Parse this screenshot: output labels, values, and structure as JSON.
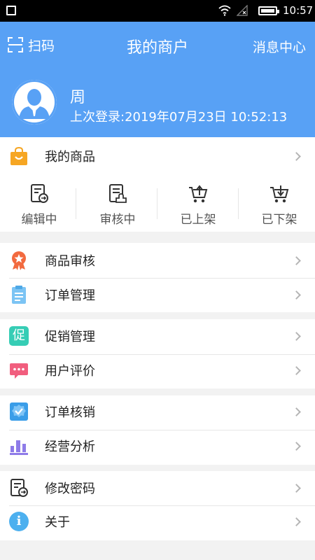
{
  "statusbar": {
    "time": "10:57"
  },
  "header": {
    "scan_label": "扫码",
    "title": "我的商户",
    "message_center": "消息中心"
  },
  "user": {
    "name": "周",
    "last_login": "上次登录:2019年07月23日 10:52:13"
  },
  "my_goods": {
    "label": "我的商品"
  },
  "goods_status": [
    {
      "label": "编辑中",
      "icon": "edit-doc-icon"
    },
    {
      "label": "审核中",
      "icon": "review-doc-icon"
    },
    {
      "label": "已上架",
      "icon": "cart-up-icon"
    },
    {
      "label": "已下架",
      "icon": "cart-down-icon"
    }
  ],
  "menu": {
    "goods_review": "商品审核",
    "order_manage": "订单管理",
    "promotion_manage": "促销管理",
    "user_review": "用户评价",
    "order_verify": "订单核销",
    "business_analysis": "经营分析",
    "change_password": "修改密码",
    "about": "关于"
  },
  "icons": {
    "promotion_char": "促",
    "about_char": "i"
  },
  "colors": {
    "header_bg": "#58a1f5",
    "bag_orange": "#f6a623",
    "badge_orange": "#f26a3f",
    "clipboard_blue": "#7cc4f4",
    "promo_teal": "#36cdb5",
    "chat_pink": "#f15e7e",
    "verify_blue": "#3a9de8",
    "chart_purple": "#8e7be8",
    "info_blue": "#4db0ef"
  }
}
